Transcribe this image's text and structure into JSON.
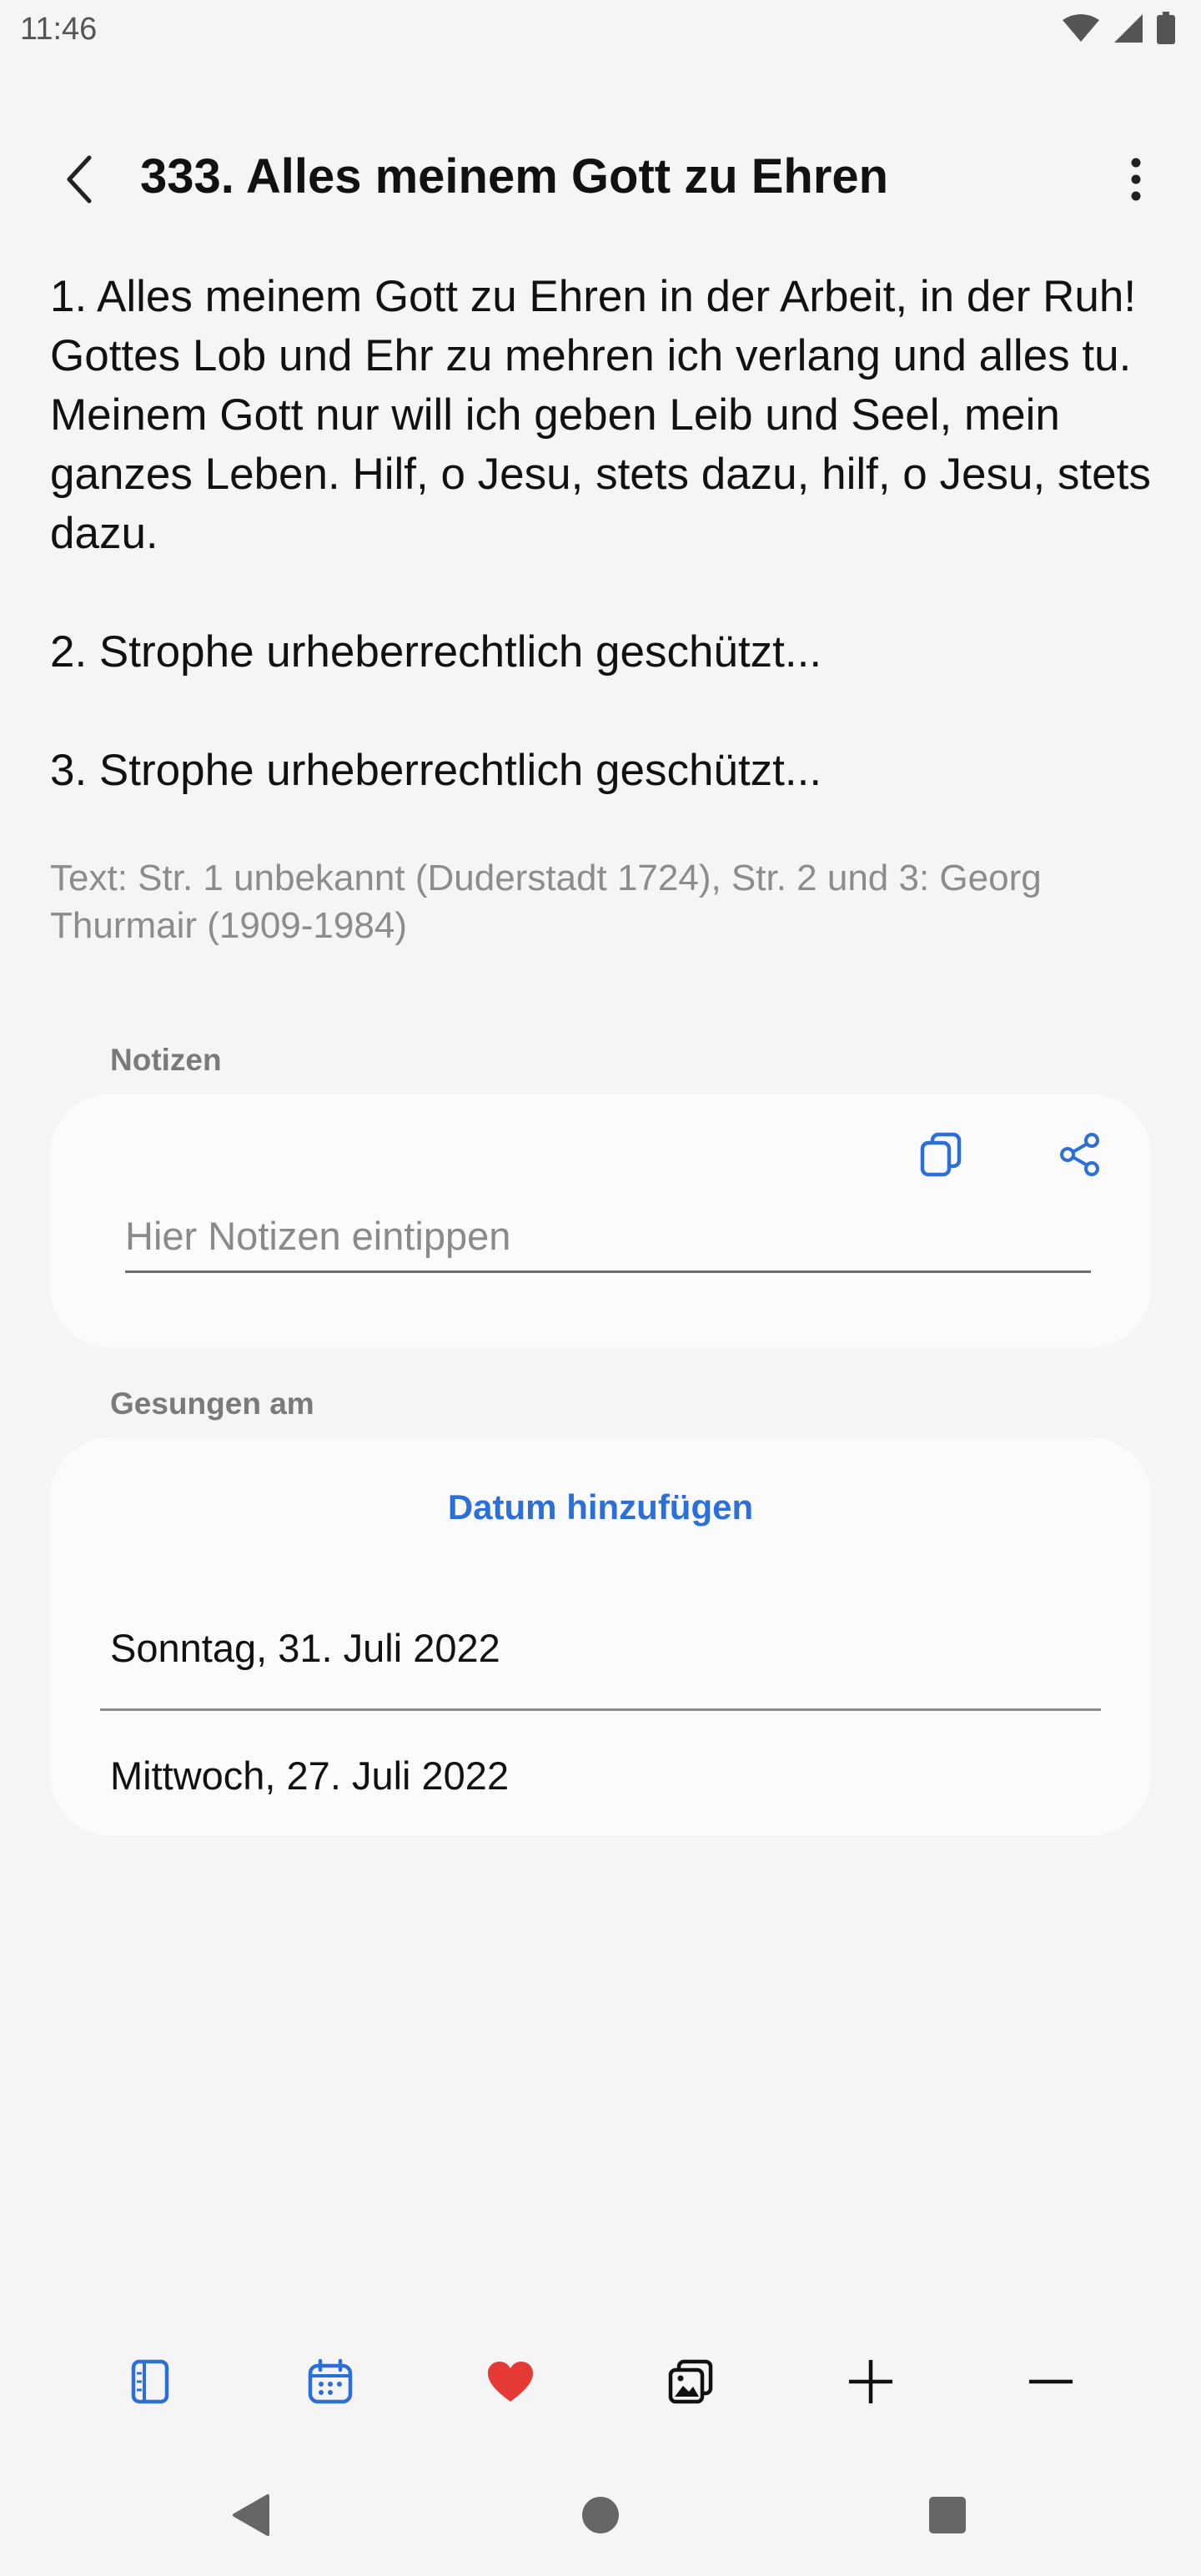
{
  "status_bar": {
    "time": "11:46"
  },
  "header": {
    "title": "333. Alles meinem Gott zu Ehren"
  },
  "lyrics": {
    "stanza1": "1. Alles meinem Gott zu Ehren in der Arbeit, in der Ruh! Gottes Lob und Ehr zu mehren ich verlang und alles tu. Meinem Gott nur will ich geben Leib und Seel, mein ganzes Leben. Hilf, o Jesu, stets dazu, hilf, o Jesu, stets dazu.",
    "stanza2": "2. Strophe urheberrechtlich geschützt...",
    "stanza3": "3. Strophe urheberrechtlich geschützt...",
    "credit": "Text: Str. 1 unbekannt (Duderstadt 1724), Str. 2 und 3: Georg Thurmair (1909-1984)"
  },
  "notes": {
    "label": "Notizen",
    "placeholder": "Hier Notizen eintippen",
    "value": ""
  },
  "sung": {
    "label": "Gesungen am",
    "add_date": "Datum hinzufügen",
    "dates": [
      "Sonntag, 31. Juli 2022",
      "Mittwoch, 27. Juli 2022"
    ]
  },
  "toolbar_icons": [
    "book-icon",
    "calendar-icon",
    "heart-icon",
    "gallery-icon",
    "plus-icon",
    "minus-icon"
  ],
  "colors": {
    "accent": "#2c6fd6",
    "favorite": "#e53935",
    "background": "#f5f5f5",
    "card": "#fbfbfb"
  }
}
